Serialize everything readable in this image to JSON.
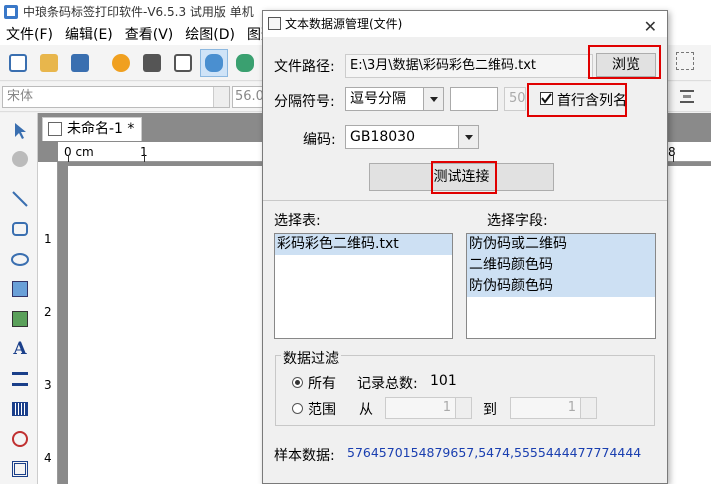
{
  "app": {
    "title": "中琅条码标签打印软件-V6.5.3 试用版 单机",
    "menu": [
      "文件(F)",
      "编辑(E)",
      "查看(V)",
      "绘图(D)",
      "图形"
    ]
  },
  "toolbar2": {
    "font": "宋体",
    "size": "56.0"
  },
  "document": {
    "tab_label": "未命名-1 *"
  },
  "ruler": {
    "h_labels": [
      "0 cm",
      "1",
      "8"
    ],
    "v_labels": [
      "1",
      "2",
      "3",
      "4"
    ]
  },
  "dialog": {
    "title": "文本数据源管理(文件)",
    "file_path_label": "文件路径:",
    "file_path_value": "E:\\3月\\数据\\彩码彩色二维码.txt",
    "browse_label": "浏览",
    "delimiter_label": "分隔符号:",
    "delimiter_value": "逗号分隔",
    "delimiter_extra": "50",
    "first_row_header_label": "首行含列名",
    "first_row_header_checked": true,
    "encoding_label": "编码:",
    "encoding_value": "GB18030",
    "test_button_label": "测试连接",
    "select_table_label": "选择表:",
    "tables": [
      "彩码彩色二维码.txt"
    ],
    "select_field_label": "选择字段:",
    "fields": [
      "防伪码或二维码",
      "二维码颜色码",
      "防伪码颜色码"
    ],
    "filter_title": "数据过滤",
    "filter_all_label": "所有",
    "record_count_label": "记录总数:",
    "record_count_value": "101",
    "filter_range_label": "范围",
    "from_label": "从",
    "from_value": "1",
    "to_label": "到",
    "to_value": "1",
    "sample_label": "样本数据:",
    "sample_value": "5764570154879657,5474,5555444477774444"
  },
  "colors": {
    "highlight_red": "#e00000",
    "sample_blue": "#1a3fb0",
    "list_selection": "#cde0f3"
  }
}
